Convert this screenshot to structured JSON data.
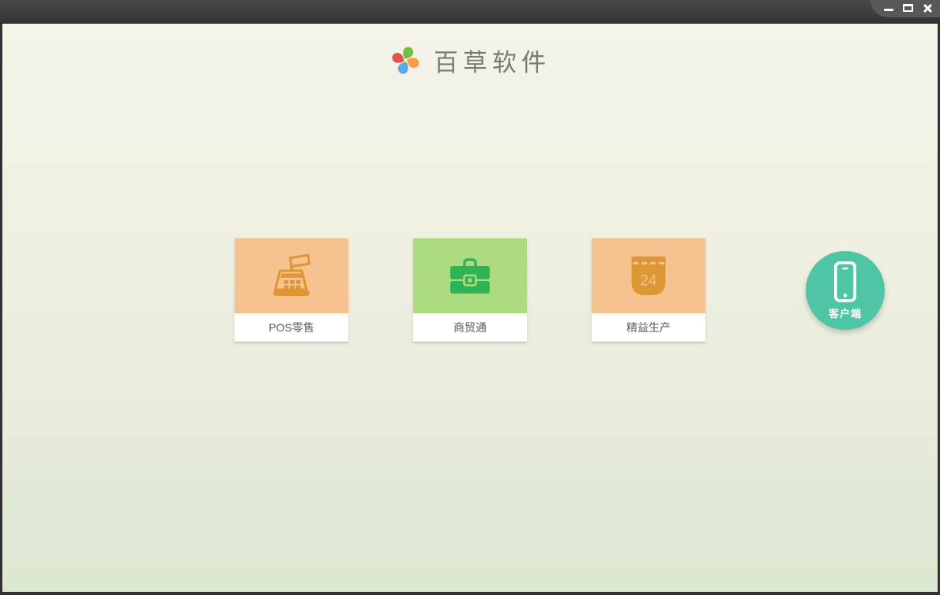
{
  "window": {
    "controls": {
      "minimize": "minimize",
      "maximize": "maximize",
      "close": "close"
    },
    "titlebar_color": "#3b3b3b"
  },
  "brand": {
    "name": "百草软件",
    "logo": "pinwheel-logo",
    "logo_colors": {
      "green": "#72bf44",
      "orange": "#f1a23c",
      "blue": "#58a9e4",
      "red": "#e25549"
    }
  },
  "products": [
    {
      "label": "POS零售",
      "icon": "cash-register-icon",
      "tile_color": "#f6c28f",
      "icon_color": "#dd9733"
    },
    {
      "label": "商贸通",
      "icon": "briefcase-icon",
      "tile_color": "#abdc80",
      "icon_color": "#2eb457"
    },
    {
      "label": "精益生产",
      "icon": "calendar-icon",
      "tile_color": "#f6c28f",
      "icon_color": "#dd9733",
      "calendar_day": "24"
    }
  ],
  "client": {
    "label": "客户端",
    "icon": "smartphone-icon",
    "color": "#4ec6a6"
  },
  "background": {
    "top": "#f6f3e9",
    "bottom": "#dce7d2"
  }
}
